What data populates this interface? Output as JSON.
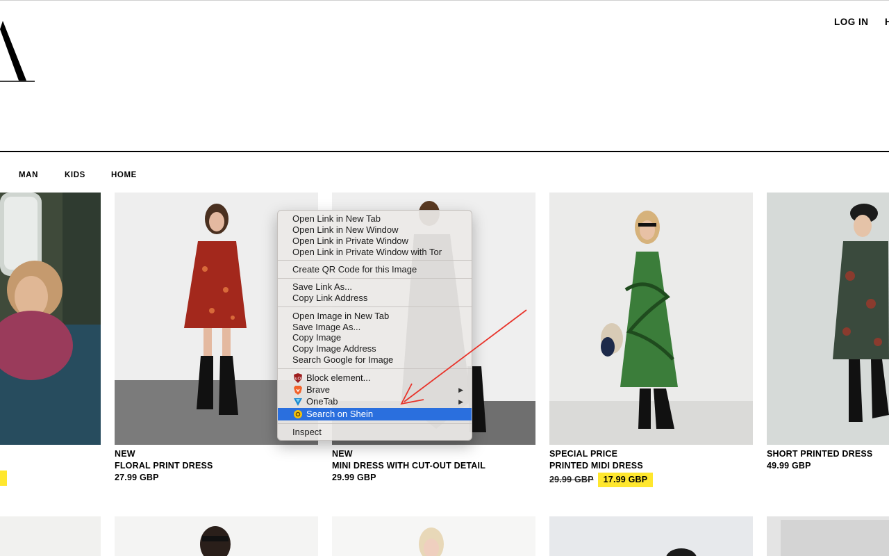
{
  "header": {
    "login_label": "LOG IN",
    "help_label": "H"
  },
  "nav": {
    "items": [
      "MAN",
      "KIDS",
      "HOME"
    ]
  },
  "products": [
    {
      "tag": "NEW",
      "name": "FLORAL PRINT DRESS",
      "price": "27.99 GBP"
    },
    {
      "tag": "NEW",
      "name": "MINI DRESS WITH CUT-OUT DETAIL",
      "price": "29.99 GBP"
    },
    {
      "tag": "SPECIAL PRICE",
      "name": "PRINTED MIDI DRESS",
      "old_price": "29.99 GBP",
      "sale_price": "17.99 GBP"
    },
    {
      "name": "SHORT PRINTED DRESS",
      "price": "49.99 GBP"
    }
  ],
  "context_menu": {
    "items": [
      "Open Link in New Tab",
      "Open Link in New Window",
      "Open Link in Private Window",
      "Open Link in Private Window with Tor",
      "Create QR Code for this Image",
      "Save Link As...",
      "Copy Link Address",
      "Open Image in New Tab",
      "Save Image As...",
      "Copy Image",
      "Copy Image Address",
      "Search Google for Image",
      "Block element...",
      "Brave",
      "OneTab",
      "Search on Shein",
      "Inspect"
    ],
    "icons": [
      "ublock-icon",
      "brave-icon",
      "onetab-icon",
      "shein-icon"
    ],
    "highlight_color": "#2a6fde"
  },
  "colors": {
    "sale_badge": "#ffe72e",
    "annotation_arrow": "#e8332a"
  }
}
